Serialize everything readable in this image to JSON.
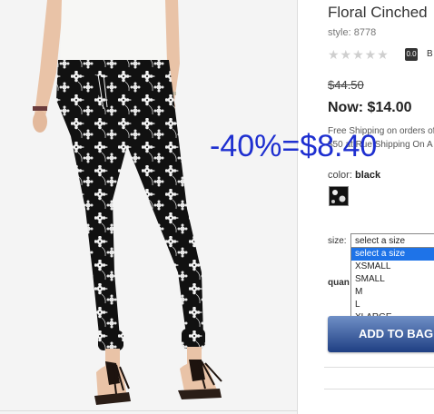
{
  "product": {
    "title": "Floral Cinched",
    "style": "style: 8778",
    "stars": "★★★★★",
    "rating": "0.0",
    "rating_extra": "B",
    "was_price": "$44.50",
    "now_price": "Now: $14.00",
    "shipping_line1": "Free Shipping on orders of $",
    "shipping_line2": "$50 at Rue Shipping On A"
  },
  "overlay_text": "-40%=$8.40",
  "color": {
    "label": "color:",
    "value": "black"
  },
  "size": {
    "label": "size:",
    "selected": "select a size",
    "options": [
      "select a size",
      "XSMALL",
      "SMALL",
      "M",
      "L",
      "XLARGE"
    ]
  },
  "quantity": {
    "label": "quan"
  },
  "add_to_bag": "ADD TO BAG",
  "colors": {
    "overlay": "#1e2fd0",
    "button": "#1f3f83",
    "highlight": "#1e73e8"
  }
}
